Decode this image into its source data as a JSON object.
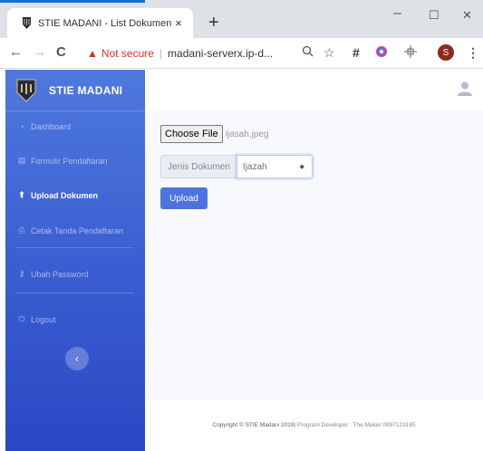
{
  "browser": {
    "tab_title": "STIE MADANI - List Dokumen",
    "tab_close": "×",
    "new_tab": "+",
    "minimize": "–",
    "maximize": "☐",
    "close": "✕",
    "back": "←",
    "forward": "→",
    "reload": "C",
    "security_warning": "Not secure",
    "url": "madani-serverx.ip-d...",
    "profile_initial": "S",
    "menu": "⋮"
  },
  "sidebar": {
    "brand": "STIE MADANI",
    "items": [
      {
        "label": "Dashboard",
        "icon": "dashboard-icon",
        "glyph": "◔",
        "active": false
      },
      {
        "label": "Formulir Pendaftaran",
        "icon": "form-icon",
        "glyph": "▤",
        "active": false
      },
      {
        "label": "Upload Dokumen",
        "icon": "upload-icon",
        "glyph": "⬆",
        "active": true
      },
      {
        "label": "Cetak Tanda Pendaftaran",
        "icon": "print-icon",
        "glyph": "⎙",
        "active": false
      },
      {
        "label": "Ubah Password",
        "icon": "key-icon",
        "glyph": "⚷",
        "active": false
      },
      {
        "label": "Logout",
        "icon": "power-icon",
        "glyph": "⏻",
        "active": false
      }
    ],
    "toggle": "‹"
  },
  "form": {
    "choose_file_label": "Choose File",
    "file_name": "ijasah.jpeg",
    "doc_type_label": "Jenis Dokumen",
    "doc_type_value": "Ijazah",
    "upload_label": "Upload"
  },
  "footer": {
    "copyright": "Copyright © STIE Madani 2019",
    "developer": " | Program Developer : The Maker 0897123165"
  },
  "colors": {
    "sidebar_top": "#4f79dd",
    "sidebar_bottom": "#2a48c4",
    "primary": "#4e73df",
    "not_secure": "#d93025"
  }
}
